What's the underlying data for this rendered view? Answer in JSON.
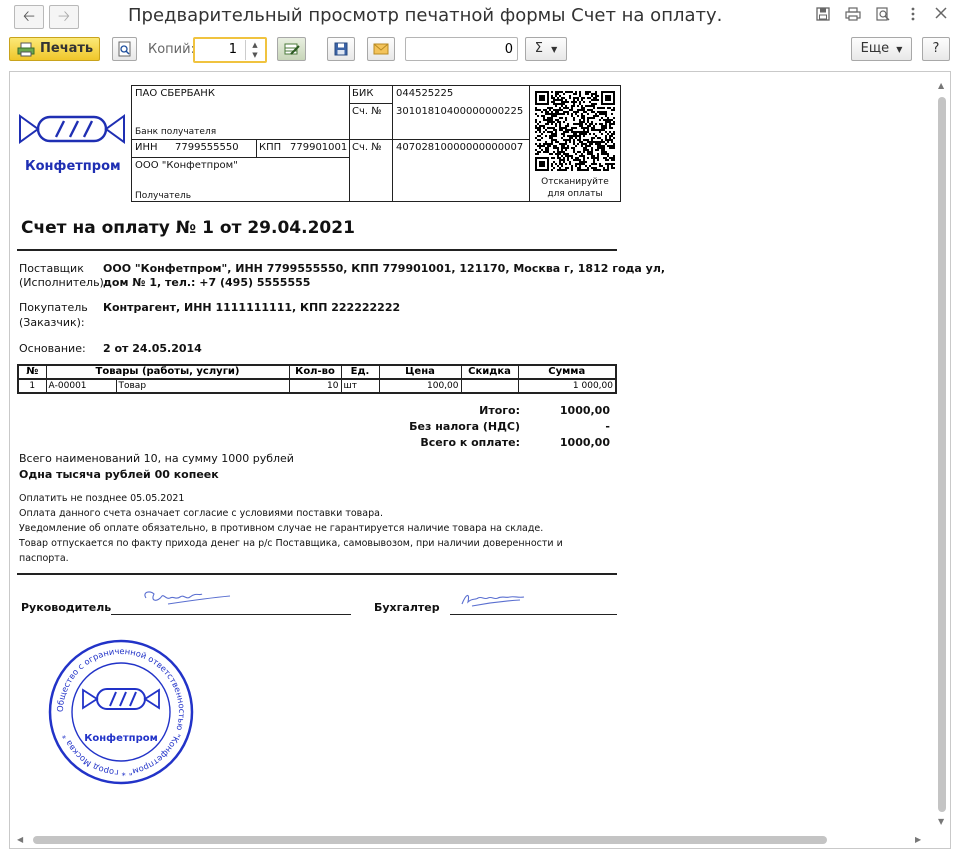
{
  "window": {
    "title": "Предварительный просмотр печатной формы Счет на оплату."
  },
  "toolbar": {
    "print_label": "Печать",
    "copies_label": "Копий:",
    "copies_value": "1",
    "sum_value": "0",
    "sigma_label": "Σ",
    "more_label": "Еще",
    "help_label": "?"
  },
  "bank": {
    "name": "ПАО СБЕРБАНК",
    "bank_label": "Банк получателя",
    "bik_label": "БИК",
    "bik_value": "044525225",
    "acc_label": "Сч. №",
    "corr_account": "30101810400000000225",
    "inn_label": "ИНН",
    "inn_value": "7799555550",
    "kpp_label": "КПП",
    "kpp_value": "779901001",
    "acc2_label": "Сч. №",
    "account": "40702810000000000007",
    "recipient_name": "ООО \"Конфетпром\"",
    "recipient_label": "Получатель",
    "qr_caption_1": "Отсканируйте",
    "qr_caption_2": "для оплаты"
  },
  "logo": {
    "text": "Конфетпром"
  },
  "invoice": {
    "title": "Счет на оплату № 1 от 29.04.2021",
    "supplier_label_1": "Поставщик",
    "supplier_label_2": "(Исполнитель):",
    "supplier_value_1": "ООО \"Конфетпром\", ИНН 7799555550, КПП 779901001, 121170, Москва г, 1812 года ул,",
    "supplier_value_2": "дом № 1, тел.: +7 (495) 5555555",
    "buyer_label_1": "Покупатель",
    "buyer_label_2": "(Заказчик):",
    "buyer_value": "Контрагент, ИНН 1111111111, КПП 222222222",
    "basis_label": "Основание:",
    "basis_value": "2 от 24.05.2014"
  },
  "table": {
    "headers": [
      "№",
      "Товары (работы, услуги)",
      "Кол-во",
      "Ед.",
      "Цена",
      "Скидка",
      "Сумма"
    ],
    "rows": [
      {
        "n": "1",
        "code": "А-00001",
        "name": "Товар",
        "qty": "10",
        "unit": "шт",
        "price": "100,00",
        "discount": "",
        "sum": "1 000,00"
      }
    ]
  },
  "totals": {
    "total_label": "Итого:",
    "total_value": "1000,00",
    "vat_label": "Без налога (НДС)",
    "vat_value": "-",
    "due_label": "Всего к оплате:",
    "due_value": "1000,00"
  },
  "summary": {
    "count_text": "Всего наименований 10, на сумму 1000 рублей",
    "words_text": "Одна тысяча рублей 00 копеек"
  },
  "notes": {
    "line1": "Оплатить не позднее 05.05.2021",
    "line2": "Оплата данного счета означает согласие с условиями поставки товара.",
    "line3": "Уведомление об оплате обязательно, в противном случае не гарантируется наличие товара на складе.",
    "line4": "Товар отпускается по факту прихода денег на р/с Поставщика, самовывозом, при наличии доверенности и",
    "line5": "паспорта."
  },
  "signatures": {
    "director_label": "Руководитель",
    "accountant_label": "Бухгалтер"
  },
  "stamp": {
    "ring_text": "Общество с ограниченной ответственностью \"Конфетпром\" * город Москва *",
    "center_text": "Конфетпром"
  },
  "colors": {
    "accent_yellow": "#f0c62a",
    "logo_blue": "#1f2fb3",
    "stamp_blue": "#2233c8",
    "signature_blue": "#5a6fd0"
  }
}
